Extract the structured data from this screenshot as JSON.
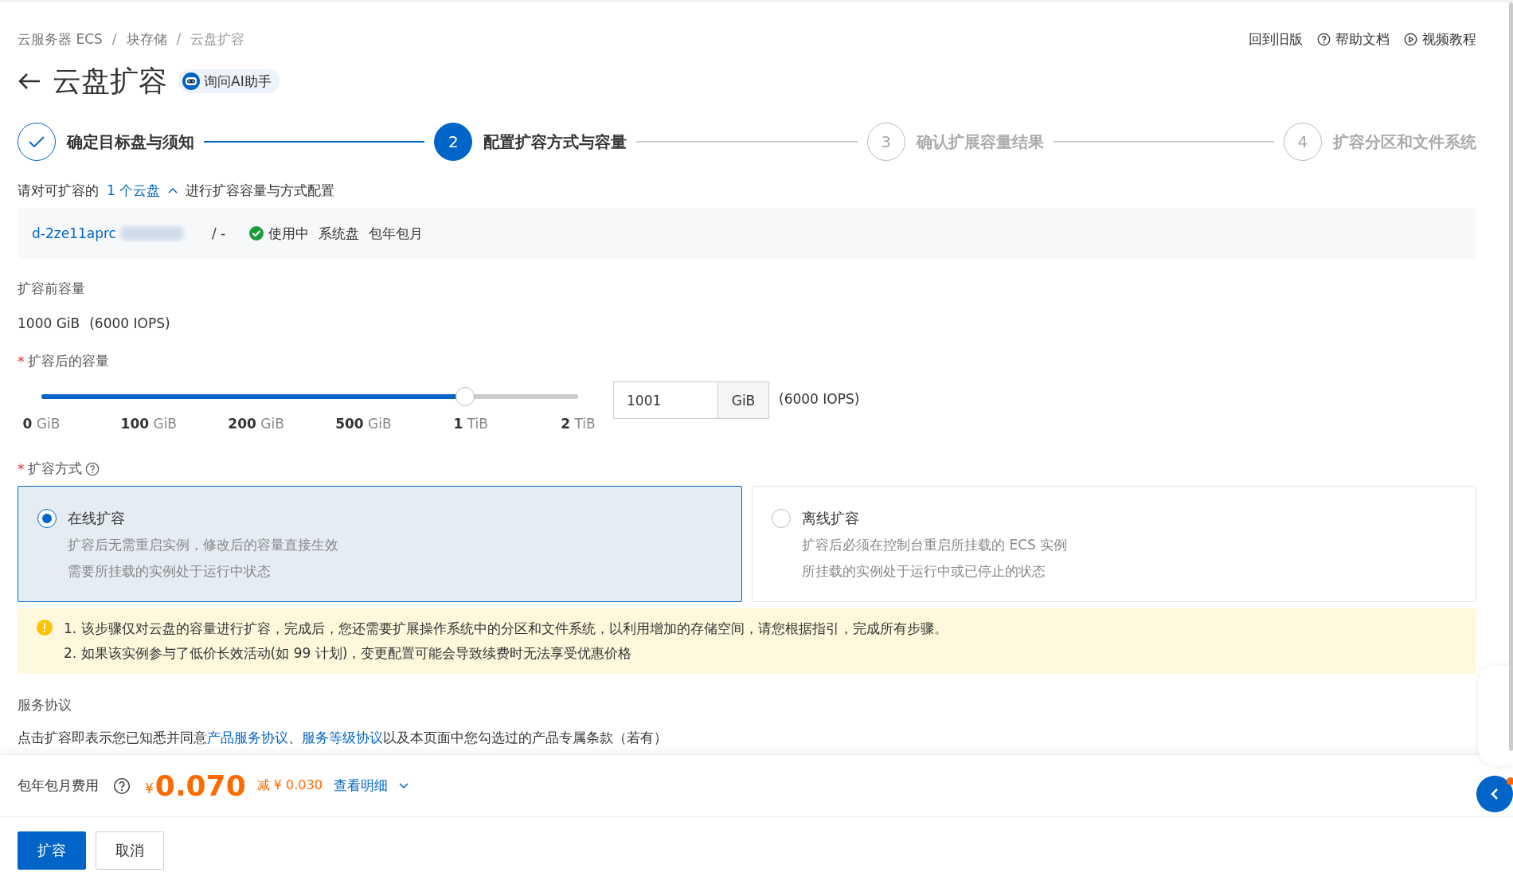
{
  "breadcrumb": [
    {
      "label": "云服务器 ECS",
      "selected": false
    },
    {
      "label": "块存储",
      "selected": false
    },
    {
      "label": "云盘扩容",
      "selected": true
    }
  ],
  "top_links": [
    {
      "kind": "plain",
      "label": "回到旧版"
    },
    {
      "kind": "help",
      "label": "帮助文档"
    },
    {
      "kind": "video",
      "label": "视频教程"
    }
  ],
  "title": "云盘扩容",
  "ai_button": "询问AI助手",
  "separator": "/",
  "steps": [
    {
      "label": "确定目标盘与须知",
      "kind": "done"
    },
    {
      "number": "2",
      "label": "配置扩容方式与容量",
      "kind": "active"
    },
    {
      "number": "3",
      "label": "确认扩展容量结果",
      "kind": "pending"
    },
    {
      "number": "4",
      "label": "扩容分区和文件系统",
      "kind": "pending"
    }
  ],
  "intro": {
    "before": "请对可扩容的",
    "link": "1 个云盘",
    "expanded": true,
    "after": "进行扩容容量与方式配置"
  },
  "disk": {
    "id": "d-2ze11aprc",
    "separator": "/  -",
    "status": "使用中",
    "type": "系统盘",
    "billing": "包年包月"
  },
  "before_capacity": {
    "label": "扩容前容量",
    "value": "1000 GiB",
    "iops": "(6000 IOPS)"
  },
  "after_capacity": {
    "label": "扩容后的容量",
    "required_mark": "*",
    "slider": {
      "level": 0.79,
      "marks": [
        {
          "number": "0",
          "unit": "GiB"
        },
        {
          "number": "100",
          "unit": "GiB"
        },
        {
          "number": "200",
          "unit": "GiB"
        },
        {
          "number": "500",
          "unit": "GiB"
        },
        {
          "number": "1",
          "unit": "TiB"
        },
        {
          "number": "2",
          "unit": "TiB"
        }
      ]
    },
    "value": "1001",
    "unit": "GiB",
    "iops": "(6000 IOPS)"
  },
  "method": {
    "label": "扩容方式",
    "required_mark": "*",
    "options": [
      {
        "title": "在线扩容",
        "lines": [
          "扩容后无需重启实例，修改后的容量直接生效",
          "需要所挂载的实例处于运行中状态"
        ],
        "selected": true
      },
      {
        "title": "离线扩容",
        "lines": [
          "扩容后必须在控制台重启所挂载的 ECS 实例",
          "所挂载的实例处于运行中或已停止的状态"
        ],
        "selected": false
      }
    ]
  },
  "notice": [
    "1. 该步骤仅对云盘的容量进行扩容，完成后，您还需要扩展操作系统中的分区和文件系统，以利用增加的存储空间，请您根据指引，完成所有步骤。",
    "2. 如果该实例参与了低价长效活动(如 99 计划)，变更配置可能会导致续费时无法享受优惠价格"
  ],
  "agreement": {
    "heading": "服务协议",
    "parts": [
      {
        "kind": "text",
        "text": "点击扩容即表示您已知悉并同意"
      },
      {
        "kind": "link",
        "text": "产品服务协议"
      },
      {
        "kind": "text",
        "text": "、"
      },
      {
        "kind": "link",
        "text": "服务等级协议"
      },
      {
        "kind": "text",
        "text": "以及本页面中您勾选过的产品专属条款（若有）"
      }
    ]
  },
  "fee": {
    "label": "包年包月费用",
    "currency": "¥",
    "price": "0.070",
    "discount": "减 ¥ 0.030",
    "detail_link": "查看明细"
  },
  "buttons": [
    {
      "label": "扩容",
      "kind": "primary"
    },
    {
      "label": "取消",
      "kind": "default"
    }
  ]
}
